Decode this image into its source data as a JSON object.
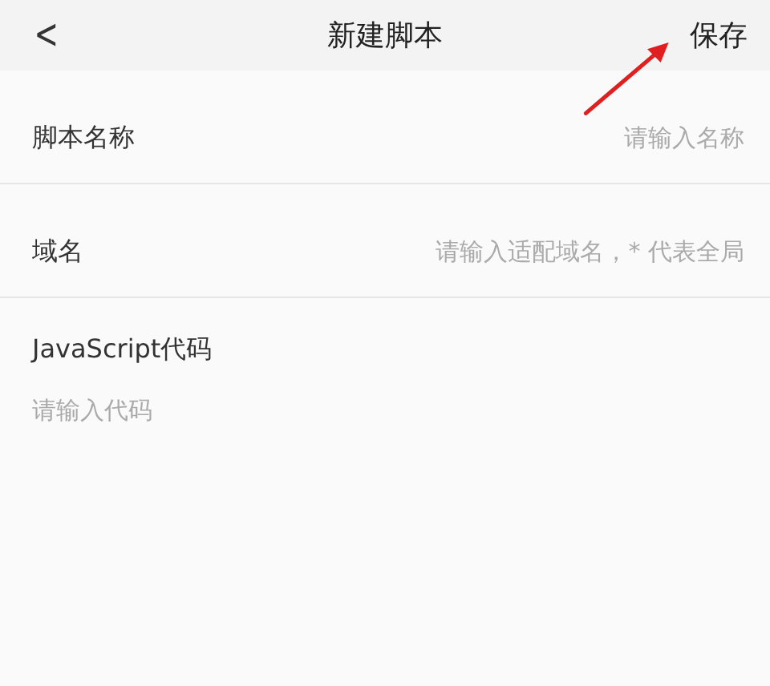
{
  "header": {
    "back": "<",
    "title": "新建脚本",
    "save": "保存"
  },
  "fields": [
    {
      "label": "脚本名称",
      "placeholder": "请输入名称"
    },
    {
      "label": "域名",
      "placeholder": "请输入适配域名，* 代表全局"
    }
  ],
  "code": {
    "label": "JavaScript代码",
    "placeholder": "请输入代码"
  }
}
